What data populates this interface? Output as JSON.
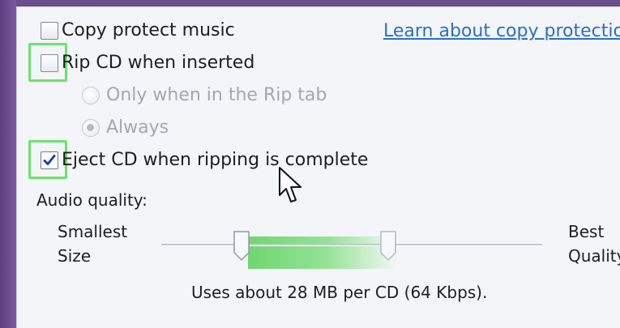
{
  "options": {
    "copy_protect": {
      "label": "Copy protect music",
      "checked": false
    },
    "rip_cd": {
      "label": "Rip CD when inserted",
      "checked": false
    },
    "rip_mode": {
      "only_in_rip_tab": {
        "label": "Only when in the Rip tab",
        "selected": false,
        "enabled": false
      },
      "always": {
        "label": "Always",
        "selected": true,
        "enabled": false
      }
    },
    "eject_cd": {
      "label": "Eject CD when ripping is complete",
      "checked": true
    }
  },
  "links": {
    "copy_protection": "Learn about copy protection"
  },
  "audio_quality": {
    "label": "Audio quality:",
    "min_label_line1": "Smallest",
    "min_label_line2": "Size",
    "max_label_line1": "Best",
    "max_label_line2": "Quality",
    "note": "Uses about 28 MB per CD (64 Kbps)."
  },
  "colors": {
    "highlight": "#6be36b",
    "link": "#2a6fc9",
    "check": "#1f3fb5"
  },
  "icons": {
    "cursor": "arrow-cursor-icon",
    "check": "checkmark-icon"
  }
}
